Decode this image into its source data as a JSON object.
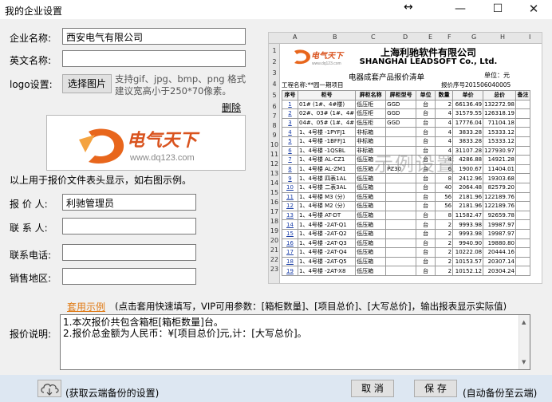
{
  "window": {
    "title": "我的企业设置",
    "resize_glyph": "↔",
    "minimize_glyph": "—",
    "maximize_glyph": "☐",
    "close_glyph": "✕"
  },
  "form": {
    "company_name_label": "企业名称:",
    "company_name_value": "西安电气有限公司",
    "english_name_label": "英文名称:",
    "english_name_value": "",
    "logo_label": "logo设置:",
    "choose_image_button": "选择图片",
    "logo_hint_line1": "支持gif、jpg、bmp、png 格式",
    "logo_hint_line2": "建议宽高小于250*70像素。",
    "delete_link": "删除",
    "logo_caption": "以上用于报价文件表头显示，如右图示例。",
    "quoter_label": "报 价 人:",
    "quoter_value": "利驰管理员",
    "contact_label": "联 系 人:",
    "contact_value": "",
    "phone_label": "联系电话:",
    "phone_value": "",
    "region_label": "销售地区:",
    "region_value": ""
  },
  "logo": {
    "brand_text": "电气天下",
    "domain_text": "www.dq123.com",
    "brand_color": "#e8661c",
    "brand_text_color": "#d9531e"
  },
  "preview": {
    "column_letters": [
      "A",
      "B",
      "C",
      "D",
      "E",
      "F",
      "G",
      "H",
      "I"
    ],
    "row_numbers": [
      "1",
      "2",
      "3",
      "4",
      "5",
      "6",
      "7",
      "8",
      "9",
      "10",
      "11",
      "12",
      "13",
      "14",
      "15",
      "16",
      "17",
      "18",
      "19",
      "20",
      "21",
      "22",
      "23"
    ],
    "title": "上海利驰软件有限公司",
    "company_en": "SHANGHAI LEADSOFT Co., Ltd.",
    "subtitle": "电器成套产品报价清单",
    "unit": "单位：元",
    "project_line": "工程名称:**园一期项目",
    "quote_no": "报价序号201506040005",
    "watermark": "示例设置",
    "headers": [
      "序号",
      "柜号",
      "屏柜名称",
      "屏柜型号",
      "单位",
      "数量",
      "单价",
      "总价",
      "备注"
    ],
    "rows": [
      [
        "1",
        "01# (1#、4#楼)",
        "低压柜",
        "GGD",
        "台",
        "2",
        "66136.49",
        "132272.98",
        ""
      ],
      [
        "2",
        "02#、03# (1#、4#",
        "低压柜",
        "GGD",
        "台",
        "4",
        "31579.55",
        "126318.19",
        ""
      ],
      [
        "3",
        "04#、05# (1#、4#",
        "低压柜",
        "GGD",
        "台",
        "4",
        "17776.04",
        "71104.18",
        ""
      ],
      [
        "4",
        "1、4号楼 -1PYFJ1",
        "非标箱",
        "",
        "台",
        "4",
        "3833.28",
        "15333.12",
        ""
      ],
      [
        "5",
        "1、4号楼 -1BFFJ1",
        "非标箱",
        "",
        "台",
        "4",
        "3833.28",
        "15333.12",
        ""
      ],
      [
        "6",
        "1、4号楼 -1QSBL",
        "非标箱",
        "",
        "台",
        "4",
        "31107.28",
        "127930.97",
        ""
      ],
      [
        "7",
        "1、4号楼 AL-CZ1",
        "低压箱",
        "",
        "台",
        "4",
        "4286.88",
        "14921.28",
        ""
      ],
      [
        "8",
        "1、4号楼 AL-ZM1",
        "低压箱",
        "PZ30",
        "台",
        "6",
        "1900.67",
        "11404.01",
        ""
      ],
      [
        "9",
        "1、4号楼 四表1AL",
        "低压箱",
        "",
        "台",
        "8",
        "2412.96",
        "19303.68",
        ""
      ],
      [
        "10",
        "1、4号楼 二表3AL",
        "低压箱",
        "",
        "台",
        "40",
        "2064.48",
        "82579.20",
        ""
      ],
      [
        "11",
        "1、4号楼 M3 (分)",
        "低压箱",
        "",
        "台",
        "56",
        "2181.96",
        "122189.76",
        ""
      ],
      [
        "12",
        "1、4号楼 M2 (分)",
        "低压箱",
        "",
        "台",
        "56",
        "2181.96",
        "122189.76",
        ""
      ],
      [
        "13",
        "1、4号楼 AT-DT",
        "低压箱",
        "",
        "台",
        "8",
        "11582.47",
        "92659.78",
        ""
      ],
      [
        "14",
        "1、4号楼 -2AT-Q1",
        "低压箱",
        "",
        "台",
        "2",
        "9993.98",
        "19987.97",
        ""
      ],
      [
        "15",
        "1、4号楼 -2AT-Q2",
        "低压箱",
        "",
        "台",
        "2",
        "9993.98",
        "19987.97",
        ""
      ],
      [
        "16",
        "1、4号楼 -2AT-Q3",
        "低压箱",
        "",
        "台",
        "2",
        "9940.90",
        "19880.80",
        ""
      ],
      [
        "17",
        "1、4号楼 -2AT-Q4",
        "低压箱",
        "",
        "台",
        "2",
        "10222.08",
        "20444.16",
        ""
      ],
      [
        "18",
        "1、4号楼 -2AT-Q5",
        "低压箱",
        "",
        "台",
        "2",
        "10153.57",
        "20307.14",
        ""
      ],
      [
        "19",
        "1、4号楼 -2AT-X8",
        "低压箱",
        "",
        "台",
        "2",
        "10152.12",
        "20304.24",
        ""
      ]
    ]
  },
  "template": {
    "apply_link": "套用示例",
    "params_hint": "(点击套用快速填写，VIP可用参数：[箱柜数量]、[项目总价]、[大写总价]，输出报表显示实际值)",
    "note_label": "报价说明:",
    "note_lines": [
      "1.本次报价共包含箱柜[箱柜数量]台。",
      "2.报价总金额为人民币：¥[项目总价]元,计：[大写总价]。"
    ]
  },
  "footer": {
    "cloud_hint": "(获取云端备份的设置)",
    "cancel_button": "取 消",
    "save_button": "保 存",
    "auto_backup_hint": "(自动备份至云端)",
    "bar_color": "#dde7f2"
  }
}
